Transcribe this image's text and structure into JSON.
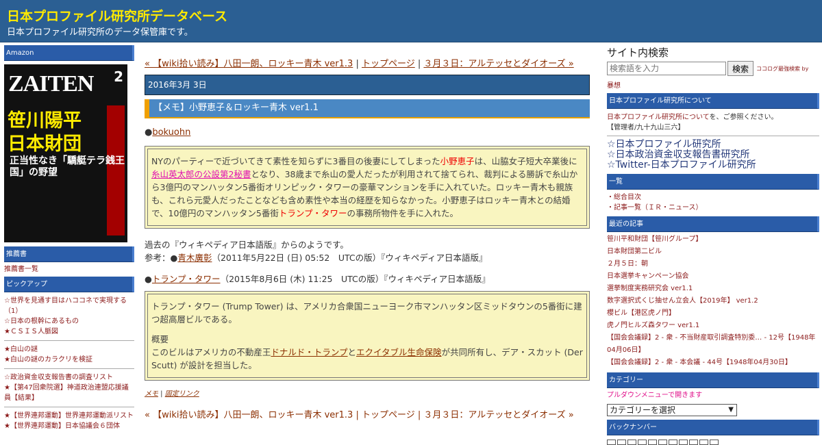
{
  "header": {
    "title": "日本プロファイル研究所データベース",
    "subtitle": "日本プロファイル研究所のデータ保管庫です。"
  },
  "left": {
    "amazon": "Amazon",
    "mag": {
      "brand": "ZAITEN",
      "issue": "2",
      "headline1": "笹川陽平",
      "headline2": "日本財団",
      "headline3": "正当性なき「驕艇テラ銭王国」の野望"
    },
    "recommend_title": "推薦書",
    "recommend_link": "推薦書一覧",
    "pickup_title": "ピックアップ",
    "pickups": [
      "☆世界を見通す目はハココネで実現する（1）",
      "☆日本の根幹にあるもの",
      "★ＣＳＩＳ人脈図",
      "★白山の謎",
      "★白山の謎のカラクリを検証",
      "☆政治資金収支報告書の調査リスト",
      "★【第47回衆院選】神道政治連盟応援議員【結果】",
      "★【世界連邦運動】世界連邦運動派リスト",
      "★【世界連邦運動】日本協議会６団体"
    ]
  },
  "main": {
    "nav": {
      "prev": "« 【wiki拾い読み】八田一朗、ロッキー青木 ver1.3",
      "sep1": " | ",
      "top": "トップページ",
      "sep2": " | ",
      "next": "３月３日：アルテッセとダイオーズ »"
    },
    "date": "2016年3月 3日",
    "entry_title": "【メモ】小野恵子＆ロッキー青木 ver1.1",
    "bullet1_dot": "●",
    "bullet1": "bokuohn",
    "box1": {
      "t1": "NYのパーティーで近づいてきて素性を知らずに3番目の後妻にしてしまった",
      "name1": "小野恵子",
      "t2": "は、山脇女子短大卒業後に",
      "name2": "糸山英太郎の公設第2秘書",
      "t3": "となり、38歳まで糸山の愛人だったが利用されて捨てられ、裁判による勝訴で糸山から3億円のマンハッタン5番街オリンピック・タワーの豪華マンションを手に入れていた。ロッキー青木も親族も、これら元愛人だったことなども含め素性や本当の経歴を知らなかった。小野恵子はロッキー青木との結婚で、10億円のマンハッタン5番街",
      "name3": "トランプ・タワー",
      "t4": "の事務所物件を手に入れた。"
    },
    "para1": "過去の『ウィキペディア日本語版』からのようです。",
    "ref_pre": "参考：●",
    "ref_link": "青木廣彰",
    "ref_post": "（2011年5月22日 (日) 05:52　UTCの版）『ウィキペディア日本語版』",
    "bullet2_dot": "●",
    "bullet2_link": "トランプ・タワー",
    "bullet2_post": "（2015年8月6日 (木) 11:25　UTCの版）『ウィキペディア日本語版』",
    "box2": {
      "t1": "トランプ・タワー (Trump Tower) は、アメリカ合衆国ニューヨーク市マンハッタン区ミッドタウンの5番街に建つ超高層ビルである。",
      "head": "概要",
      "t2": "このビルはアメリカの不動産王",
      "link1": "ドナルド・トランプ",
      "t3": "と",
      "link2": "エクイタブル生命保険",
      "t4": "が共同所有し、デア・スカット (Der Scutt) が設計を担当した。"
    },
    "footer": {
      "memo": "メモ",
      "sep": " | ",
      "perma": "固定リンク"
    },
    "nav2": "« 【wiki拾い読み】八田一朗、ロッキー青木 ver1.3 | トップページ | ３月３日：アルテッセとダイオーズ »"
  },
  "right": {
    "search_title": "サイト内検索",
    "search_placeholder": "検索語を入力",
    "search_button": "検索",
    "search_note": "ココログ最強検索 by",
    "search_note2": "暴想",
    "about_title": "日本プロファイル研究所について",
    "about_link": "日本プロファイル研究所について",
    "about_tail": "を、ご参照ください。",
    "admin": "【管理者/九十九山三六】",
    "stars": [
      "☆日本プロファイル研究所",
      "☆日本政治資金収支報告書研究所",
      "☆Twitter-日本プロファイル研究所"
    ],
    "list_title": "一覧",
    "list_items": [
      "・総合目次",
      "・記事一覧（ＩＲ・ニュース）"
    ],
    "recent_title": "最近の記事",
    "recent_items": [
      "笹川平和財団【笹川グループ】",
      "日本財団第二ビル",
      "２月５日：朝",
      "日本選挙キャンペーン協会",
      "選挙制度実務研究会 ver1.1",
      "数字選択式くじ抽せん立会人【2019年】 ver1.2",
      "櫻ビル【港区虎ノ門】",
      "虎ノ門ヒルズ森タワー ver1.1",
      "【国会会議録】2 - 衆 - 不当財産取引調査特別委… - 12号【1948年04月06日】",
      "【国会会議録】2 - 衆 - 本会議 - 44号【1948年04月30日】"
    ],
    "category_title": "カテゴリー",
    "category_note": "プルダウンメニューで開きます",
    "category_select": "カテゴリーを選択",
    "backnumber_title": "バックナンバー"
  }
}
